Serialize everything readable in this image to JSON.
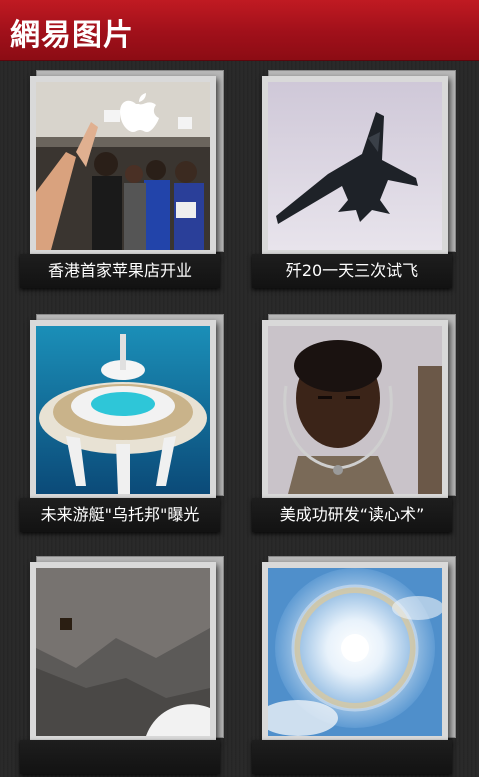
{
  "header": {
    "title": "網易图片"
  },
  "gallery": {
    "items": [
      {
        "caption": "香港首家苹果店开业"
      },
      {
        "caption": "歼20一天三次试飞"
      },
      {
        "caption": "未来游艇\"乌托邦\"曝光"
      },
      {
        "caption": "美成功研发“读心术”"
      },
      {
        "caption": ""
      },
      {
        "caption": ""
      }
    ]
  }
}
